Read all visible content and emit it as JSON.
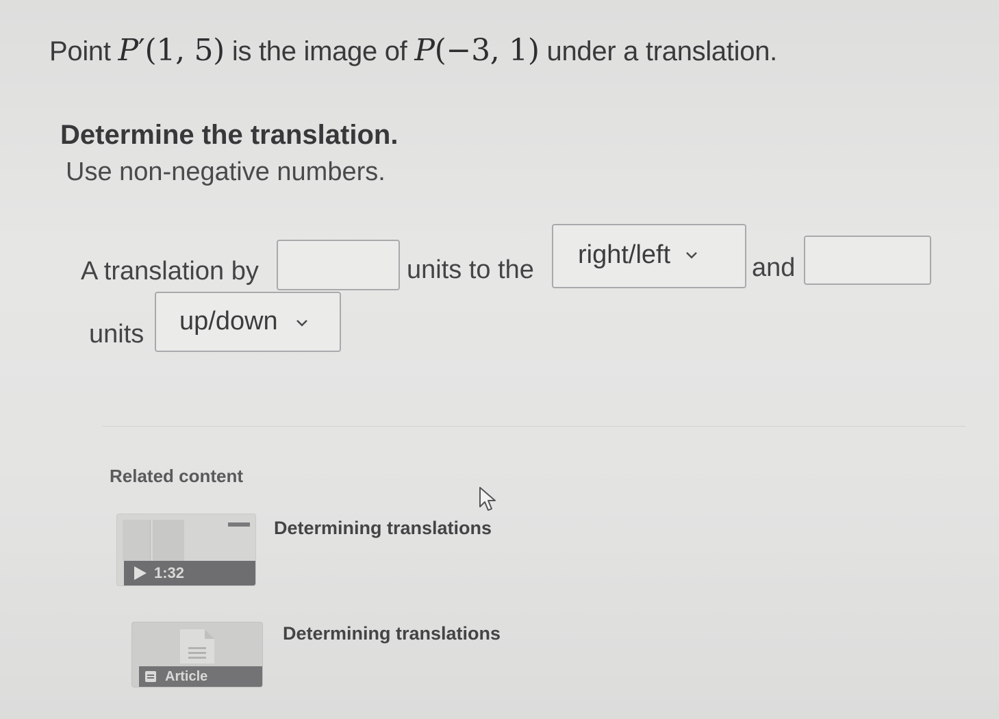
{
  "question": {
    "prefix": "Point",
    "image_point": {
      "name": "P",
      "prime": "′",
      "coords": "(1, 5)"
    },
    "middle": "is the image of",
    "original_point": {
      "name": "P",
      "coords": "(−3, 1)"
    },
    "suffix": "under a translation."
  },
  "heading": "Determine the translation.",
  "instruction": "Use non-negative numbers.",
  "answer_sentence": {
    "part1": "A translation by",
    "input1_value": "",
    "part2": "units to the",
    "select1_value": "right/left",
    "part3": "and",
    "input2_value": "",
    "part4": "units",
    "select2_value": "up/down"
  },
  "related": {
    "title": "Related content",
    "items": [
      {
        "type": "video",
        "badge": "1:32",
        "title": "Determining translations"
      },
      {
        "type": "article",
        "badge": "Article",
        "title": "Determining translations"
      }
    ]
  },
  "icons": [
    "chevron-down-icon",
    "play-icon",
    "article-icon",
    "mouse-cursor-icon"
  ]
}
